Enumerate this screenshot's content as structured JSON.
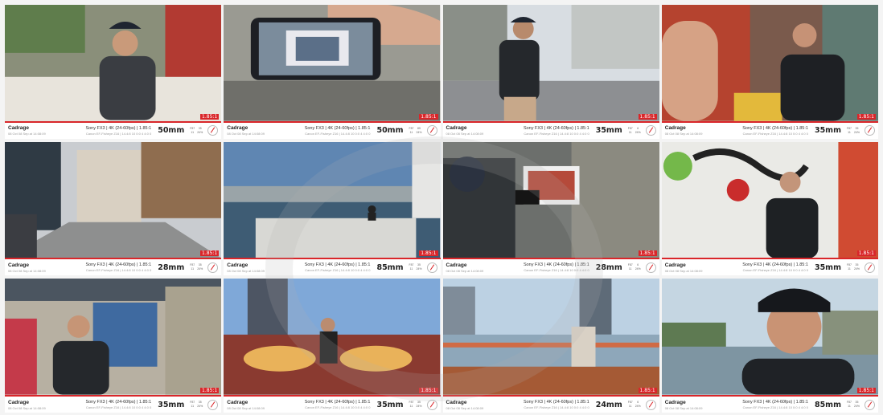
{
  "colors": {
    "accent": "#d9262a",
    "bar_bg": "#ffffff"
  },
  "tiles": [
    {
      "app": "Cadrage",
      "app_sub": "08 Oct 08 Sep at 14:08:09",
      "rec": "1.85:1",
      "spec": "Sony FX3 | 4K (24-60fps) | 1.85:1",
      "spec_sub": "Canon EF-Fisheye Z16 | 14.4:8 10 0:0 4 4:0 0",
      "focal": "50mm",
      "stat1": "F87",
      "stat1_sub": "11",
      "stat2": "35",
      "stat2_sub": "24%",
      "scene": "man at table"
    },
    {
      "app": "Cadrage",
      "app_sub": "08 Oct 08 Sep at 14:08:09",
      "rec": "1.85:1",
      "spec": "Sony FX3 | 4K (24-60fps) | 1.85:1",
      "spec_sub": "Canon EF-Fisheye Z16 | 14.4:8 10 0:0 4 4:0 0",
      "focal": "50mm",
      "stat1": "F87",
      "stat1_sub": "11",
      "stat2": "85",
      "stat2_sub": "24%",
      "scene": "phone in hand"
    },
    {
      "app": "Cadrage",
      "app_sub": "08 Oct 08 Sep at 14:08:09",
      "rec": "1.85:1",
      "spec": "Sony FX3 | 4K (24-60fps) | 1.85:1",
      "spec_sub": "Canon EF-Fisheye Z16 | 14.4:8 10 0:0 4 4:0 0",
      "focal": "35mm",
      "stat1": "F87",
      "stat1_sub": "11",
      "stat2": "6",
      "stat2_sub": "24%",
      "scene": "man in street"
    },
    {
      "app": "Cadrage",
      "app_sub": "08 Oct 08 Sep at 14:08:09",
      "rec": "1.85:1",
      "spec": "Sony FX3 | 4K (24-60fps) | 1.85:1",
      "spec_sub": "Canon EF-Fisheye Z16 | 14.4:8 10 0:0 4 4:0 0",
      "focal": "35mm",
      "stat1": "F87",
      "stat1_sub": "11",
      "stat2": "35",
      "stat2_sub": "24%",
      "scene": "man seated"
    },
    {
      "app": "Cadrage",
      "app_sub": "08 Oct 08 Sep at 14:08:09",
      "rec": "1.85:1",
      "spec": "Sony FX3 | 4K (24-60fps) | 1.85:1",
      "spec_sub": "Canon EF-Fisheye Z16 | 14.4:8 10 0:0 4 4:0 0",
      "focal": "28mm",
      "stat1": "F87",
      "stat1_sub": "11",
      "stat2": "35",
      "stat2_sub": "24%",
      "scene": "empty alley"
    },
    {
      "app": "Cadrage",
      "app_sub": "08 Oct 08 Sep at 14:08:09",
      "rec": "1.85:1",
      "spec": "Sony FX3 | 4K (24-60fps) | 1.85:1",
      "spec_sub": "Canon EF-Fisheye Z16 | 14.4:8 10 0:0 4 4:0 0",
      "focal": "85mm",
      "stat1": "F87",
      "stat1_sub": "11",
      "stat2": "35",
      "stat2_sub": "24%",
      "scene": "river skyline"
    },
    {
      "app": "Cadrage",
      "app_sub": "08 Oct 08 Sep at 14:08:09",
      "rec": "1.85:1",
      "spec": "Sony FX3 | 4K (24-60fps) | 1.85:1",
      "spec_sub": "Canon EF-Fisheye Z16 | 14.4:8 10 0:0 4 4:0 0",
      "focal": "28mm",
      "stat1": "F87",
      "stat1_sub": "11",
      "stat2": "6",
      "stat2_sub": "24%",
      "scene": "phone framing"
    },
    {
      "app": "Cadrage",
      "app_sub": "08 Oct 08 Sep at 14:08:09",
      "rec": "1.85:1",
      "spec": "Sony FX3 | 4K (24-60fps) | 1.85:1",
      "spec_sub": "Canon EF-Fisheye Z16 | 14.4:8 10 0:0 4 4:0 0",
      "focal": "35mm",
      "stat1": "F87",
      "stat1_sub": "11",
      "stat2": "35",
      "stat2_sub": "24%",
      "scene": "love mural"
    },
    {
      "app": "Cadrage",
      "app_sub": "08 Oct 08 Sep at 14:08:09",
      "rec": "1.85:1",
      "spec": "Sony FX3 | 4K (24-60fps) | 1.85:1",
      "spec_sub": "Canon EF-Fisheye Z16 | 14.4:8 10 0:0 4 4:0 0",
      "focal": "35mm",
      "stat1": "F87",
      "stat1_sub": "11",
      "stat2": "35",
      "stat2_sub": "24%",
      "scene": "man in lane"
    },
    {
      "app": "Cadrage",
      "app_sub": "08 Oct 08 Sep at 14:08:09",
      "rec": "1.85:1",
      "spec": "Sony FX3 | 4K (24-60fps) | 1.85:1",
      "spec_sub": "Canon EF-Fisheye Z16 | 14.4:8 10 0:0 4 4:0 0",
      "focal": "35mm",
      "stat1": "F87",
      "stat1_sub": "11",
      "stat2": "35",
      "stat2_sub": "24%",
      "scene": "fish mural"
    },
    {
      "app": "Cadrage",
      "app_sub": "08 Oct 08 Sep at 14:08:09",
      "rec": "1.85:1",
      "spec": "Sony FX3 | 4K (24-60fps) | 1.85:1",
      "spec_sub": "Canon EF-Fisheye Z16 | 14.4:8 10 0:0 4 4:0 0",
      "focal": "24mm",
      "stat1": "F87",
      "stat1_sub": "11",
      "stat2": "6",
      "stat2_sub": "24%",
      "scene": "riverside deck"
    },
    {
      "app": "Cadrage",
      "app_sub": "08 Oct 08 Sep at 14:08:09",
      "rec": "1.85:1",
      "spec": "Sony FX3 | 4K (24-60fps) | 1.85:1",
      "spec_sub": "Canon EF-Fisheye Z16 | 14.4:8 10 0:0 4 4:0 0",
      "focal": "85mm",
      "stat1": "F87",
      "stat1_sub": "11",
      "stat2": "35",
      "stat2_sub": "24%",
      "scene": "man by river"
    }
  ]
}
